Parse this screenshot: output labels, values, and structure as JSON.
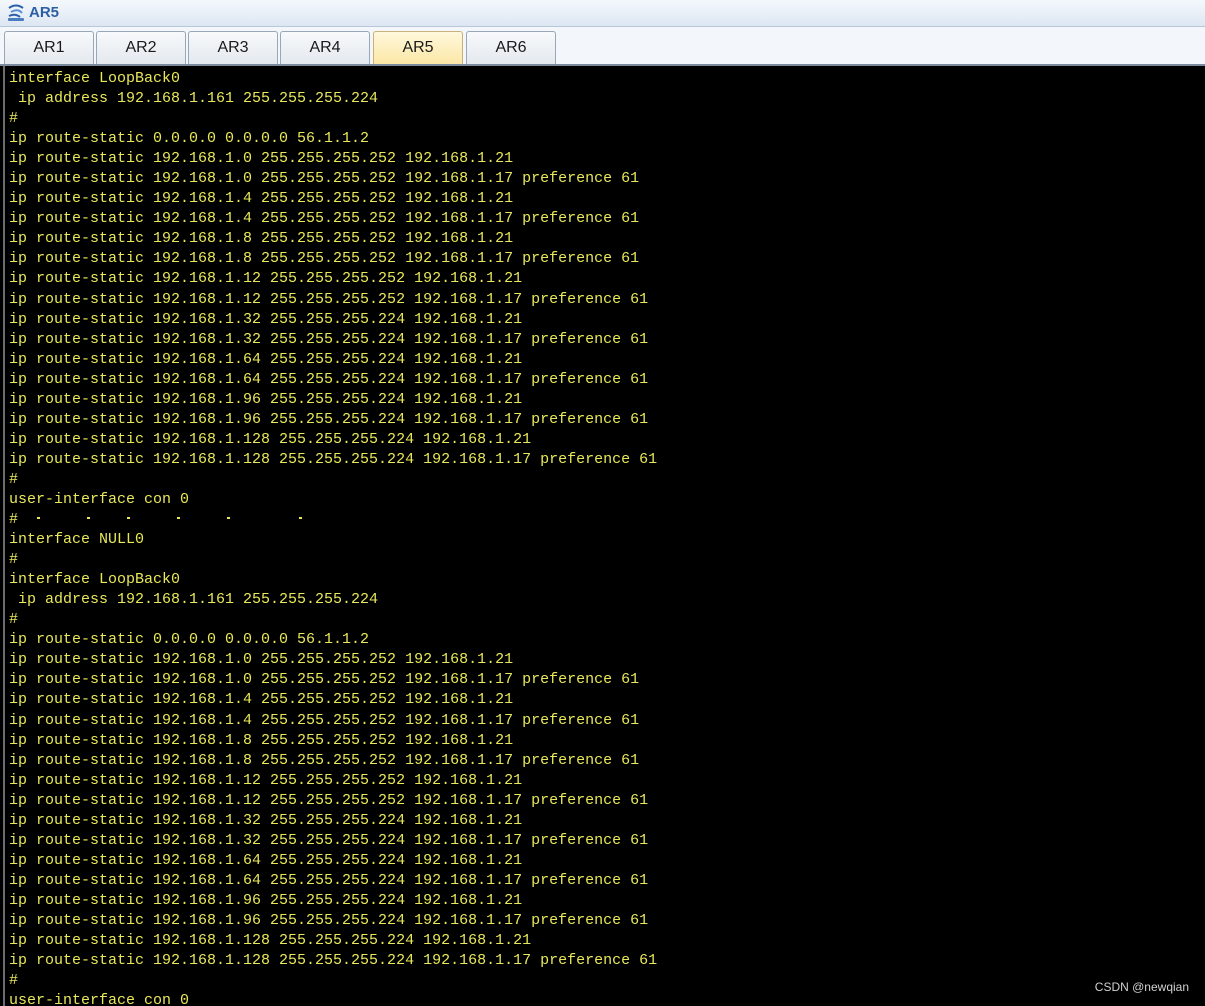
{
  "window": {
    "title": "AR5",
    "icon": "router-icon"
  },
  "tabs": [
    {
      "label": "AR1",
      "active": false
    },
    {
      "label": "AR2",
      "active": false
    },
    {
      "label": "AR3",
      "active": false
    },
    {
      "label": "AR4",
      "active": false
    },
    {
      "label": "AR5",
      "active": true
    },
    {
      "label": "AR6",
      "active": false
    }
  ],
  "terminal": {
    "text_color": "#e8e85a",
    "background": "#000000",
    "lines": [
      "interface LoopBack0",
      " ip address 192.168.1.161 255.255.255.224",
      "#",
      "ip route-static 0.0.0.0 0.0.0.0 56.1.1.2",
      "ip route-static 192.168.1.0 255.255.255.252 192.168.1.21",
      "ip route-static 192.168.1.0 255.255.255.252 192.168.1.17 preference 61",
      "ip route-static 192.168.1.4 255.255.255.252 192.168.1.21",
      "ip route-static 192.168.1.4 255.255.255.252 192.168.1.17 preference 61",
      "ip route-static 192.168.1.8 255.255.255.252 192.168.1.21",
      "ip route-static 192.168.1.8 255.255.255.252 192.168.1.17 preference 61",
      "ip route-static 192.168.1.12 255.255.255.252 192.168.1.21",
      "ip route-static 192.168.1.12 255.255.255.252 192.168.1.17 preference 61",
      "ip route-static 192.168.1.32 255.255.255.224 192.168.1.21",
      "ip route-static 192.168.1.32 255.255.255.224 192.168.1.17 preference 61",
      "ip route-static 192.168.1.64 255.255.255.224 192.168.1.21",
      "ip route-static 192.168.1.64 255.255.255.224 192.168.1.17 preference 61",
      "ip route-static 192.168.1.96 255.255.255.224 192.168.1.21",
      "ip route-static 192.168.1.96 255.255.255.224 192.168.1.17 preference 61",
      "ip route-static 192.168.1.128 255.255.255.224 192.168.1.21",
      "ip route-static 192.168.1.128 255.255.255.224 192.168.1.17 preference 61",
      "#",
      "user-interface con 0",
      "#",
      "interface NULL0",
      "#",
      "interface LoopBack0",
      " ip address 192.168.1.161 255.255.255.224",
      "#",
      "ip route-static 0.0.0.0 0.0.0.0 56.1.1.2",
      "ip route-static 192.168.1.0 255.255.255.252 192.168.1.21",
      "ip route-static 192.168.1.0 255.255.255.252 192.168.1.17 preference 61",
      "ip route-static 192.168.1.4 255.255.255.252 192.168.1.21",
      "ip route-static 192.168.1.4 255.255.255.252 192.168.1.17 preference 61",
      "ip route-static 192.168.1.8 255.255.255.252 192.168.1.21",
      "ip route-static 192.168.1.8 255.255.255.252 192.168.1.17 preference 61",
      "ip route-static 192.168.1.12 255.255.255.252 192.168.1.21",
      "ip route-static 192.168.1.12 255.255.255.252 192.168.1.17 preference 61",
      "ip route-static 192.168.1.32 255.255.255.224 192.168.1.21",
      "ip route-static 192.168.1.32 255.255.255.224 192.168.1.17 preference 61",
      "ip route-static 192.168.1.64 255.255.255.224 192.168.1.21",
      "ip route-static 192.168.1.64 255.255.255.224 192.168.1.17 preference 61",
      "ip route-static 192.168.1.96 255.255.255.224 192.168.1.21",
      "ip route-static 192.168.1.96 255.255.255.224 192.168.1.17 preference 61",
      "ip route-static 192.168.1.128 255.255.255.224 192.168.1.21",
      "ip route-static 192.168.1.128 255.255.255.224 192.168.1.17 preference 61",
      "#",
      "user-interface con 0"
    ]
  },
  "watermark": "CSDN @newqian"
}
